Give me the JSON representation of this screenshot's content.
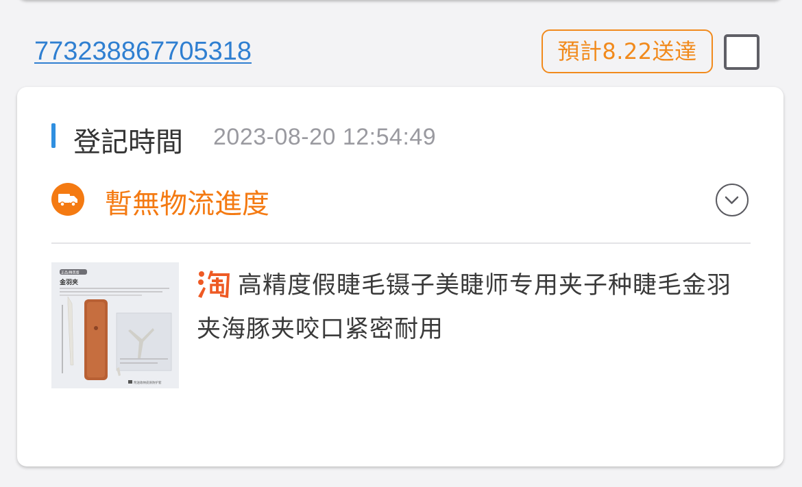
{
  "order": {
    "tracking_number": "773238867705318",
    "eta_badge": "預計8.22送達"
  },
  "card": {
    "registration_label": "登記時間",
    "registration_time": "2023-08-20 12:54:49",
    "logistics_status": "暫無物流進度",
    "product": {
      "title": "高精度假睫毛镊子美睫师专用夹子种睫毛金羽夹海豚夹咬口紧密耐用",
      "store_icon": "taobao-icon",
      "thumbnail": {
        "tag": "正品/精英版",
        "name": "金羽夹",
        "footer": "附送收纳皮质防护套"
      }
    }
  },
  "colors": {
    "link": "#2f7fd1",
    "accent_orange": "#f47a12",
    "badge_orange": "#f18a1c",
    "accent_blue": "#2f8fe0"
  }
}
